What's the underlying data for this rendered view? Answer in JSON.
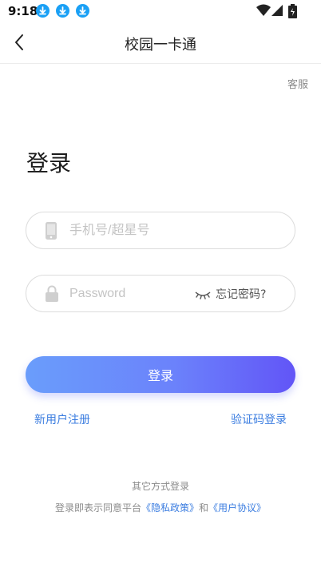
{
  "status_bar": {
    "time": "9:18",
    "download_icons": [
      "download-icon",
      "download-icon",
      "download-icon"
    ]
  },
  "nav": {
    "title": "校园一卡通",
    "back_icon": "chevron-left-icon"
  },
  "service_link": "客服",
  "heading": "登录",
  "phone_field": {
    "placeholder": "手机号/超星号",
    "value": "",
    "icon": "phone-icon"
  },
  "password_field": {
    "placeholder": "Password",
    "value": "",
    "icon": "lock-icon",
    "eye_icon": "eye-closed-icon",
    "forgot_label": "忘记密码?"
  },
  "login_button": {
    "label": "登录"
  },
  "links": {
    "register": "新用户注册",
    "code_login": "验证码登录"
  },
  "footer": {
    "other_methods": "其它方式登录",
    "agreement_prefix": "登录即表示同意平台",
    "privacy_link": "《隐私政策》",
    "and": "和",
    "user_agreement_link": "《用户协议》"
  },
  "colors": {
    "accent": "#3b7de0",
    "button_gradient_start": "#6a9dfb",
    "button_gradient_end": "#6255f7"
  }
}
